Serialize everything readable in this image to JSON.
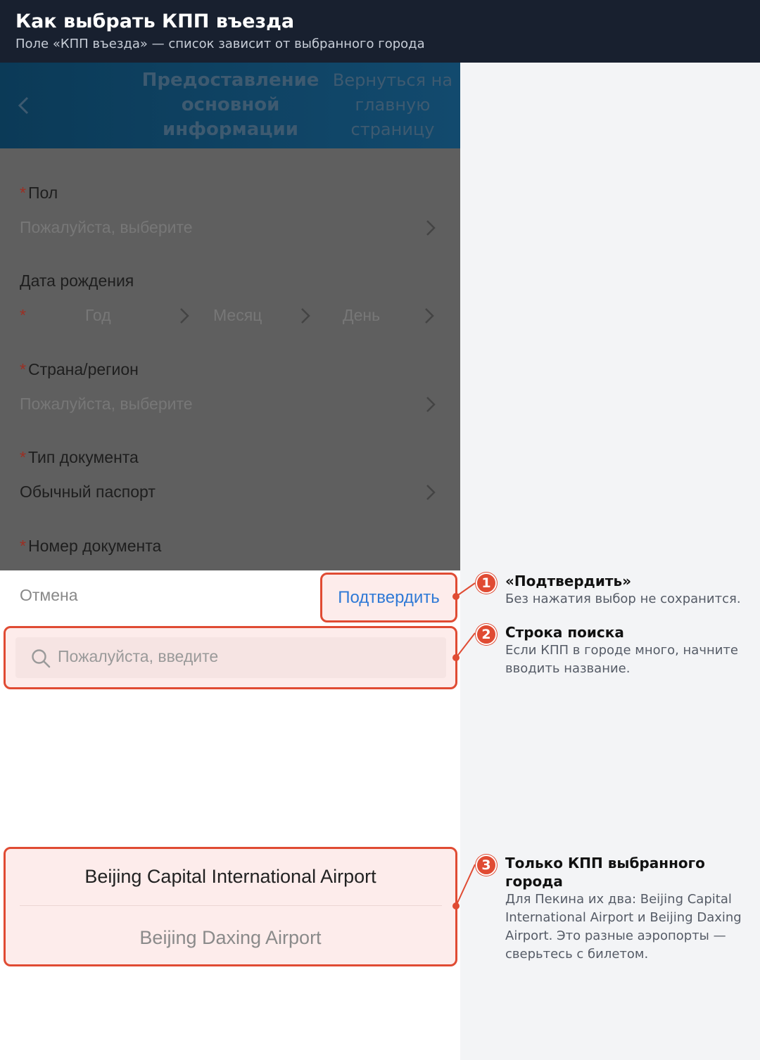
{
  "page": {
    "title": "Как выбрать КПП въезда",
    "subtitle": "Поле «КПП въезда» — список зависит от выбранного города"
  },
  "app_header": {
    "title": "Предоставление основной информации",
    "home_link": "Вернуться на главную страницу"
  },
  "form": {
    "required_mark": "*",
    "gender_label": "Пол",
    "gender_placeholder": "Пожалуйста, выберите",
    "birth_label": "Дата рождения",
    "year_placeholder": "Год",
    "month_placeholder": "Месяц",
    "day_placeholder": "День",
    "country_label": "Страна/регион",
    "country_placeholder": "Пожалуйста, выберите",
    "doc_type_label": "Тип документа",
    "doc_type_value": "Обычный паспорт",
    "doc_number_label": "Номер документа"
  },
  "picker": {
    "cancel_label": "Отмена",
    "confirm_label": "Подтвердить",
    "search_placeholder": "Пожалуйста, введите",
    "options": [
      {
        "label": "Beijing Capital International Airport",
        "selected": true
      },
      {
        "label": "Beijing Daxing Airport",
        "selected": false
      }
    ]
  },
  "annotations": [
    {
      "number": "1",
      "title": "«Подтвердить»",
      "text": "Без нажатия выбор не сохранится."
    },
    {
      "number": "2",
      "title": "Строка поиска",
      "text": "Если КПП в городе много, начните вводить название."
    },
    {
      "number": "3",
      "title": "Только КПП выбранного города",
      "text": "Для Пекина их два: Beijing Capital International Airport и Beijing Daxing Airport. Это разные аэропорты — сверьтесь с билетом."
    }
  ],
  "colors": {
    "accent": "#e04b33",
    "link_blue": "#2f79d6",
    "header_bg": "#18202f",
    "app_header_bg": "#0b3a57"
  }
}
